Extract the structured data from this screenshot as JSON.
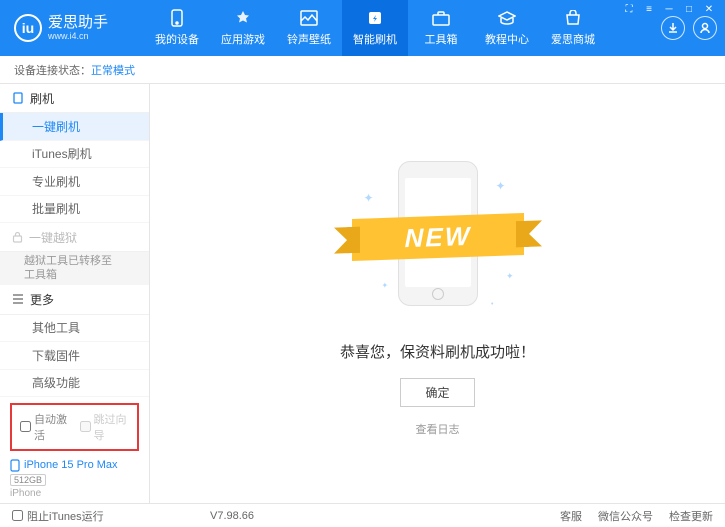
{
  "header": {
    "app_name": "爱思助手",
    "app_url": "www.i4.cn",
    "nav": [
      {
        "label": "我的设备"
      },
      {
        "label": "应用游戏"
      },
      {
        "label": "铃声壁纸"
      },
      {
        "label": "智能刷机"
      },
      {
        "label": "工具箱"
      },
      {
        "label": "教程中心"
      },
      {
        "label": "爱思商城"
      }
    ]
  },
  "status": {
    "label": "设备连接状态：",
    "mode": "正常模式"
  },
  "sidebar": {
    "group_flash": "刷机",
    "items_flash": [
      "一键刷机",
      "iTunes刷机",
      "专业刷机",
      "批量刷机"
    ],
    "group_jailbreak": "一键越狱",
    "jailbreak_note": "越狱工具已转移至\n工具箱",
    "group_more": "更多",
    "items_more": [
      "其他工具",
      "下载固件",
      "高级功能"
    ],
    "checkboxes": {
      "auto_activate": "自动激活",
      "skip_guide": "跳过向导"
    },
    "device": {
      "name": "iPhone 15 Pro Max",
      "storage": "512GB",
      "type": "iPhone"
    }
  },
  "main": {
    "ribbon": "NEW",
    "message": "恭喜您，保资料刷机成功啦！",
    "ok_button": "确定",
    "log_link": "查看日志"
  },
  "footer": {
    "block_itunes": "阻止iTunes运行",
    "version": "V7.98.66",
    "links": [
      "客服",
      "微信公众号",
      "检查更新"
    ]
  }
}
